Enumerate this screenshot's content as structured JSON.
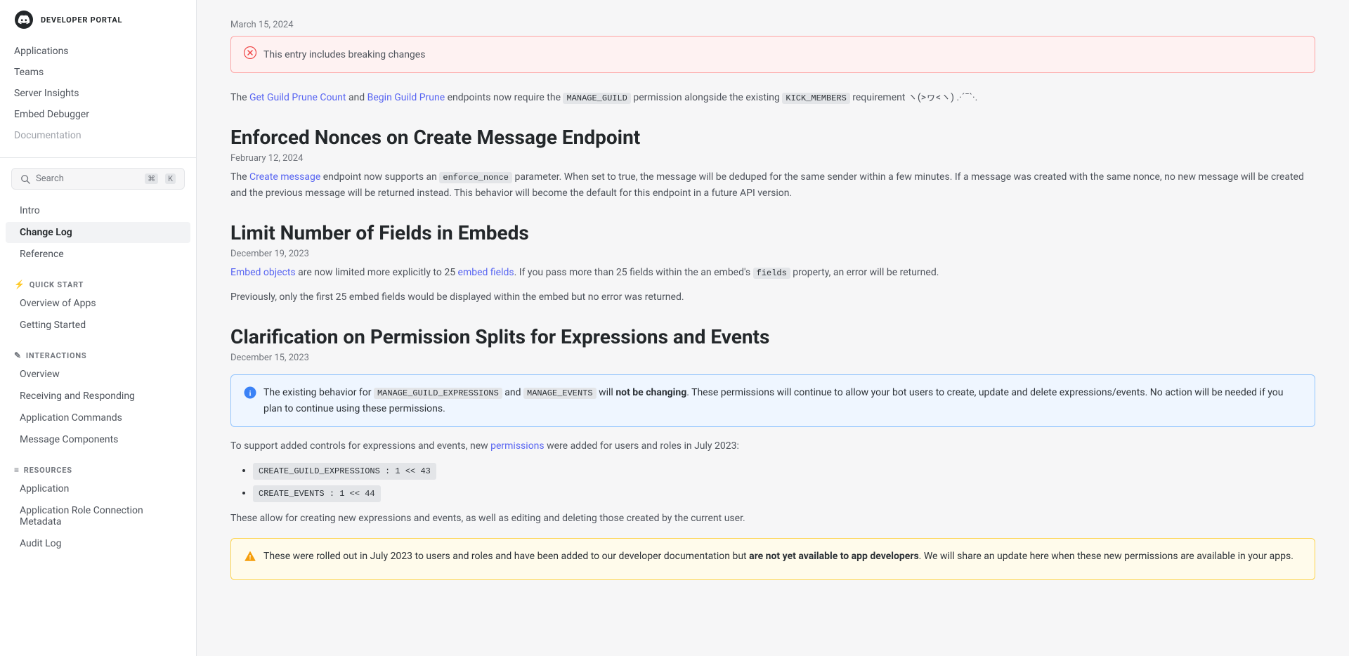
{
  "logo": {
    "text": "DEVELOPER PORTAL"
  },
  "sidebar": {
    "top_links": [
      {
        "label": "Applications",
        "id": "applications"
      },
      {
        "label": "Teams",
        "id": "teams"
      },
      {
        "label": "Server Insights",
        "id": "server-insights"
      },
      {
        "label": "Embed Debugger",
        "id": "embed-debugger"
      },
      {
        "label": "Documentation",
        "id": "documentation"
      }
    ],
    "search": {
      "placeholder": "Search",
      "shortcut1": "⌘",
      "shortcut2": "K"
    },
    "nav_links": [
      {
        "label": "Intro",
        "id": "intro",
        "active": false
      },
      {
        "label": "Change Log",
        "id": "change-log",
        "active": true
      },
      {
        "label": "Reference",
        "id": "reference",
        "active": false
      }
    ],
    "quick_start_header": "QUICK START",
    "quick_start_links": [
      {
        "label": "Overview of Apps",
        "id": "overview-apps"
      },
      {
        "label": "Getting Started",
        "id": "getting-started"
      }
    ],
    "interactions_header": "INTERACTIONS",
    "interactions_links": [
      {
        "label": "Overview",
        "id": "overview"
      },
      {
        "label": "Receiving and Responding",
        "id": "receiving-responding"
      },
      {
        "label": "Application Commands",
        "id": "app-commands"
      },
      {
        "label": "Message Components",
        "id": "message-components"
      }
    ],
    "resources_header": "RESOURCES",
    "resources_links": [
      {
        "label": "Application",
        "id": "application"
      },
      {
        "label": "Application Role Connection Metadata",
        "id": "app-role-metadata"
      },
      {
        "label": "Audit Log",
        "id": "audit-log"
      }
    ]
  },
  "main": {
    "alert_error_text": "This entry includes breaking changes",
    "block1": {
      "date": "March 15, 2024",
      "text_before": "The ",
      "link1_text": "Get Guild Prune Count",
      "text_mid1": " and ",
      "link2_text": "Begin Guild Prune",
      "text_mid2": " endpoints now require the ",
      "code1": "MANAGE_GUILD",
      "text_mid3": " permission alongside the existing ",
      "code2": "KICK_MEMBERS",
      "text_end": " requirement ヽ(>ヮ<ヽ) .·´¯`·."
    },
    "section1": {
      "title": "Enforced Nonces on Create Message Endpoint",
      "date": "February 12, 2024",
      "text_before": "The ",
      "link_text": "Create message",
      "text_mid": " endpoint now supports an ",
      "code1": "enforce_nonce",
      "text_after": " parameter. When set to true, the message will be deduped for the same sender within a few minutes. If a message was created with the same nonce, no new message will be created and the previous message will be returned instead. This behavior will become the default for this endpoint in a future API version."
    },
    "section2": {
      "title": "Limit Number of Fields in Embeds",
      "date": "December 19, 2023",
      "text_before": "",
      "link1_text": "Embed objects",
      "text_mid1": " are now limited more explicitly to 25 ",
      "link2_text": "embed fields",
      "text_mid2": ". If you pass more than 25 fields within the an embed's ",
      "code1": "fields",
      "text_mid3": " property, an error will be returned.",
      "text2": "Previously, only the first 25 embed fields would be displayed within the embed but no error was returned."
    },
    "section3": {
      "title": "Clarification on Permission Splits for Expressions and Events",
      "date": "December 15, 2023",
      "info_alert": {
        "text_before": "The existing behavior for ",
        "code1": "MANAGE_GUILD_EXPRESSIONS",
        "text_mid1": " and ",
        "code2": "MANAGE_EVENTS",
        "text_mid2": " will ",
        "bold_text": "not be changing",
        "text_end": ". These permissions will continue to allow your bot users to create, update and delete expressions/events. No action will be needed if you plan to continue using these permissions."
      },
      "body_text": "To support added controls for expressions and events, new ",
      "link_text": "permissions",
      "body_text2": " were added for users and roles in July 2023:",
      "bullets": [
        "CREATE_GUILD_EXPRESSIONS : 1 << 43",
        "CREATE_EVENTS : 1 << 44"
      ],
      "body_text3": "These allow for creating new expressions and events, as well as editing and deleting those created by the current user.",
      "warning_alert": {
        "text_before": "These were rolled out in July 2023 to users and roles and have been added to our developer documentation but ",
        "bold_text": "are not yet available to app developers",
        "text_end": ". We will share an update here when these new permissions are available in your apps."
      }
    }
  },
  "icons": {
    "discord": "discord-icon",
    "search": "search-icon",
    "error_circle": "✕",
    "info_circle": "ℹ",
    "warning": "⚠",
    "quick_start": "⚡",
    "interactions": "✎",
    "resources": "≡"
  }
}
